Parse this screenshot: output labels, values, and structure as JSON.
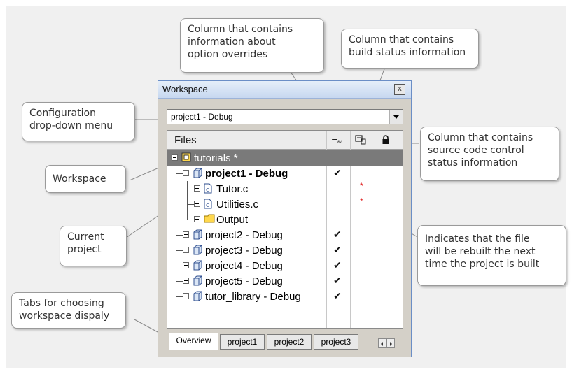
{
  "callouts": {
    "overrides": [
      "Column that contains",
      "information about",
      "option overrides"
    ],
    "build_status": [
      "Column that contains",
      "build status information"
    ],
    "config": [
      "Configuration",
      "drop-down menu"
    ],
    "source_control": [
      "Column that contains",
      "source code control",
      "status information"
    ],
    "workspace": [
      "Workspace"
    ],
    "current_project": [
      "Current",
      "project"
    ],
    "rebuild": [
      "Indicates that the file",
      "will be rebuilt the next",
      "time the project is built"
    ],
    "tabs": [
      "Tabs for choosing",
      "workspace dispaly"
    ]
  },
  "window": {
    "title": "Workspace",
    "close_label": "x",
    "config_value": "project1 - Debug",
    "files_header": "Files"
  },
  "tree": [
    {
      "label": "tutorials *",
      "icon": "workspace-icon",
      "selected": true
    },
    {
      "label": "project1 - Debug",
      "icon": "project-icon",
      "bold": true,
      "check": "✔"
    },
    {
      "label": "Tutor.c",
      "icon": "c-file-icon",
      "star": "*"
    },
    {
      "label": "Utilities.c",
      "icon": "c-file-icon",
      "star": "*"
    },
    {
      "label": "Output",
      "icon": "folder-icon"
    },
    {
      "label": "project2 - Debug",
      "icon": "project-icon",
      "check": "✔"
    },
    {
      "label": "project3 - Debug",
      "icon": "project-icon",
      "check": "✔"
    },
    {
      "label": "project4 - Debug",
      "icon": "project-icon",
      "check": "✔"
    },
    {
      "label": "project5 - Debug",
      "icon": "project-icon",
      "check": "✔"
    },
    {
      "label": "tutor_library - Debug",
      "icon": "project-icon",
      "check": "✔"
    }
  ],
  "tabs": [
    "Overview",
    "project1",
    "project2",
    "project3"
  ],
  "colors": {
    "window_border": "#6b8ec6",
    "selected_row": "#7a7a7a",
    "rebuild_star": "#e02020"
  }
}
